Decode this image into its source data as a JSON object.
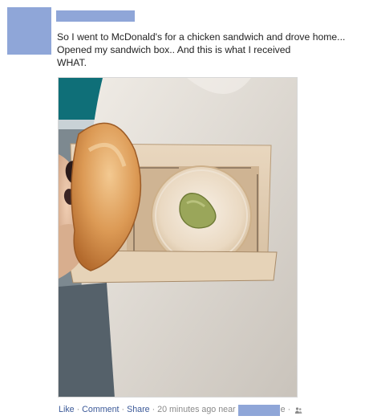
{
  "post": {
    "text": "So I went to McDonald's for a chicken sandwich and drove home... Opened my sandwich box.. And this is what I received\nWHAT."
  },
  "footer": {
    "like": "Like",
    "comment": "Comment",
    "share": "Share",
    "separator": "·",
    "time": "20 minutes ago near",
    "location_tail": "e",
    "audience_icon": "friends-icon"
  },
  "colors": {
    "link": "#3b5998",
    "meta": "#8a8a8a",
    "redaction": "#8fa6d8"
  }
}
